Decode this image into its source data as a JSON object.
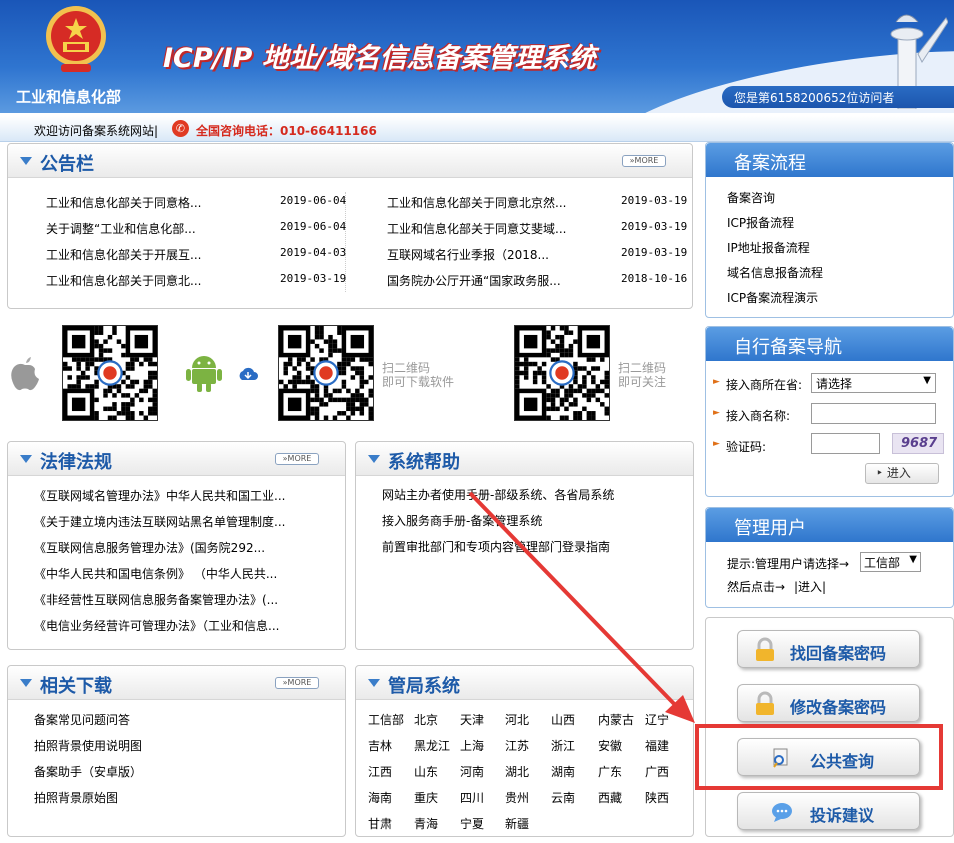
{
  "header": {
    "ministry": "工业和信息化部",
    "system_title": "ICP/IP 地址/域名信息备案管理系统",
    "visitor": "您是第6158200652位访问者"
  },
  "welcome_bar": {
    "welcome": "欢迎访问备案系统网站|",
    "hotline": "全国咨询电话：010-66411166"
  },
  "bulletin": {
    "title": "公告栏",
    "more": "MORE",
    "items_left": [
      {
        "title": "工业和信息化部关于同意格...",
        "date": "2019-06-04"
      },
      {
        "title": "关于调整“工业和信息化部...",
        "date": "2019-06-04"
      },
      {
        "title": "工业和信息化部关于开展互...",
        "date": "2019-04-03"
      },
      {
        "title": "工业和信息化部关于同意北...",
        "date": "2019-03-19"
      }
    ],
    "items_right": [
      {
        "title": "工业和信息化部关于同意北京然...",
        "date": "2019-03-19"
      },
      {
        "title": "工业和信息化部关于同意艾斐域...",
        "date": "2019-03-19"
      },
      {
        "title": "互联网域名行业季报（2018...",
        "date": "2019-03-19"
      },
      {
        "title": "国务院办公厅开通“国家政务服...",
        "date": "2018-10-16"
      }
    ]
  },
  "qr": {
    "download_label": "扫二维码\n即可下载软件",
    "follow_label": "扫二维码\n即可关注"
  },
  "laws": {
    "title": "法律法规",
    "more": "MORE",
    "items": [
      "《互联网域名管理办法》中华人民共和国工业...",
      "《关于建立境内违法互联网站黑名单管理制度...",
      "《互联网信息服务管理办法》(国务院292...",
      "《中华人民共和国电信条例》 （中华人民共...",
      "《非经营性互联网信息服务备案管理办法》(...",
      "《电信业务经营许可管理办法》（工业和信息..."
    ]
  },
  "help": {
    "title": "系统帮助",
    "items": [
      "网站主办者使用手册-部级系统、各省局系统",
      "接入服务商手册-备案管理系统",
      "前置审批部门和专项内容管理部门登录指南"
    ]
  },
  "downloads": {
    "title": "相关下载",
    "more": "MORE",
    "items": [
      "备案常见问题问答",
      "拍照背景使用说明图",
      "备案助手（安卓版）",
      "拍照背景原始图"
    ]
  },
  "bureau": {
    "title": "管局系统",
    "provinces": [
      [
        "工信部",
        "北京",
        "天津",
        "河北",
        "山西",
        "内蒙古",
        "辽宁"
      ],
      [
        "吉林",
        "黑龙江",
        "上海",
        "江苏",
        "浙江",
        "安徽",
        "福建"
      ],
      [
        "江西",
        "山东",
        "河南",
        "湖北",
        "湖南",
        "广东",
        "广西"
      ],
      [
        "海南",
        "重庆",
        "四川",
        "贵州",
        "云南",
        "西藏",
        "陕西"
      ],
      [
        "甘肃",
        "青海",
        "宁夏",
        "新疆"
      ]
    ]
  },
  "process": {
    "title": "备案流程",
    "items": [
      "备案咨询",
      "ICP报备流程",
      "IP地址报备流程",
      "域名信息报备流程",
      "ICP备案流程演示"
    ]
  },
  "nav": {
    "title": "自行备案导航",
    "province_label": "接入商所在省:",
    "province_value": "请选择",
    "name_label": "接入商名称:",
    "code_label": "验证码:",
    "captcha": "9687",
    "enter": "进入"
  },
  "admin": {
    "title": "管理用户",
    "hint": "提示:管理用户请选择→",
    "select_value": "工信部",
    "then": "然后点击→",
    "enter": "|进入|"
  },
  "buttons": {
    "recover": "找回备案密码",
    "modify": "修改备案密码",
    "query": "公共查询",
    "complaint": "投诉建议"
  },
  "colors": {
    "brand_blue": "#2f75d0",
    "highlight_red": "#e53935",
    "hotline_red": "#d52a1e"
  }
}
